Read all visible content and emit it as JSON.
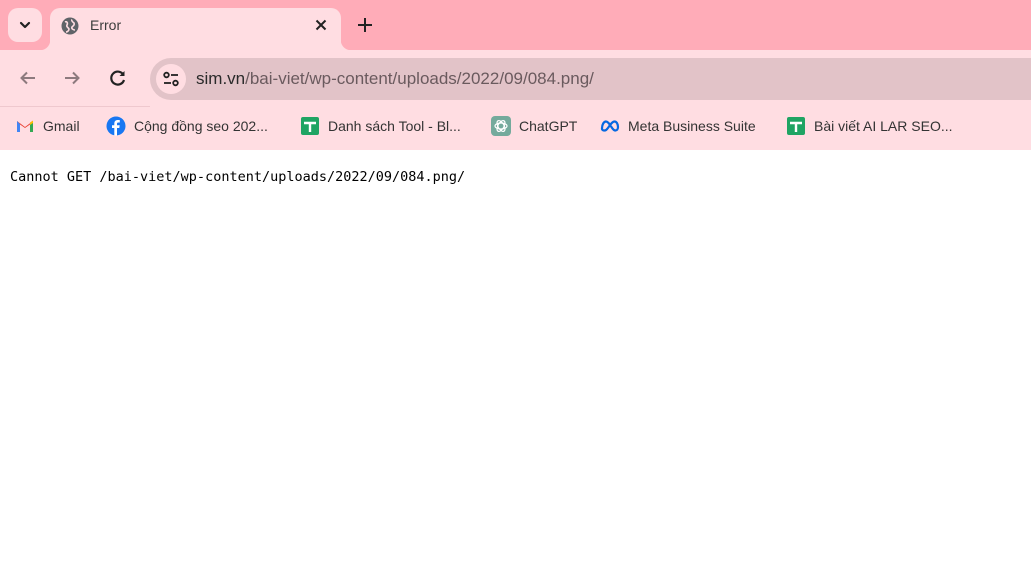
{
  "browser": {
    "tab": {
      "title": "Error",
      "favicon": "globe-icon"
    },
    "address_bar": {
      "host": "sim.vn",
      "path": "/bai-viet/wp-content/uploads/2022/09/084.png/"
    },
    "bookmarks": [
      {
        "label": "Gmail",
        "icon": "gmail-icon"
      },
      {
        "label": "Cộng đồng seo 202...",
        "icon": "facebook-icon"
      },
      {
        "label": "Danh sách Tool - Bl...",
        "icon": "google-sheets-icon"
      },
      {
        "label": "ChatGPT",
        "icon": "chatgpt-icon"
      },
      {
        "label": "Meta Business Suite",
        "icon": "meta-icon"
      },
      {
        "label": "Bài viết AI LAR SEO...",
        "icon": "google-sheets-icon"
      }
    ],
    "colors": {
      "tabstrip": "#ffacb8",
      "toolbar": "#ffdde2",
      "omnibox": "#e2c3c8"
    }
  },
  "page": {
    "message": "Cannot GET /bai-viet/wp-content/uploads/2022/09/084.png/"
  }
}
